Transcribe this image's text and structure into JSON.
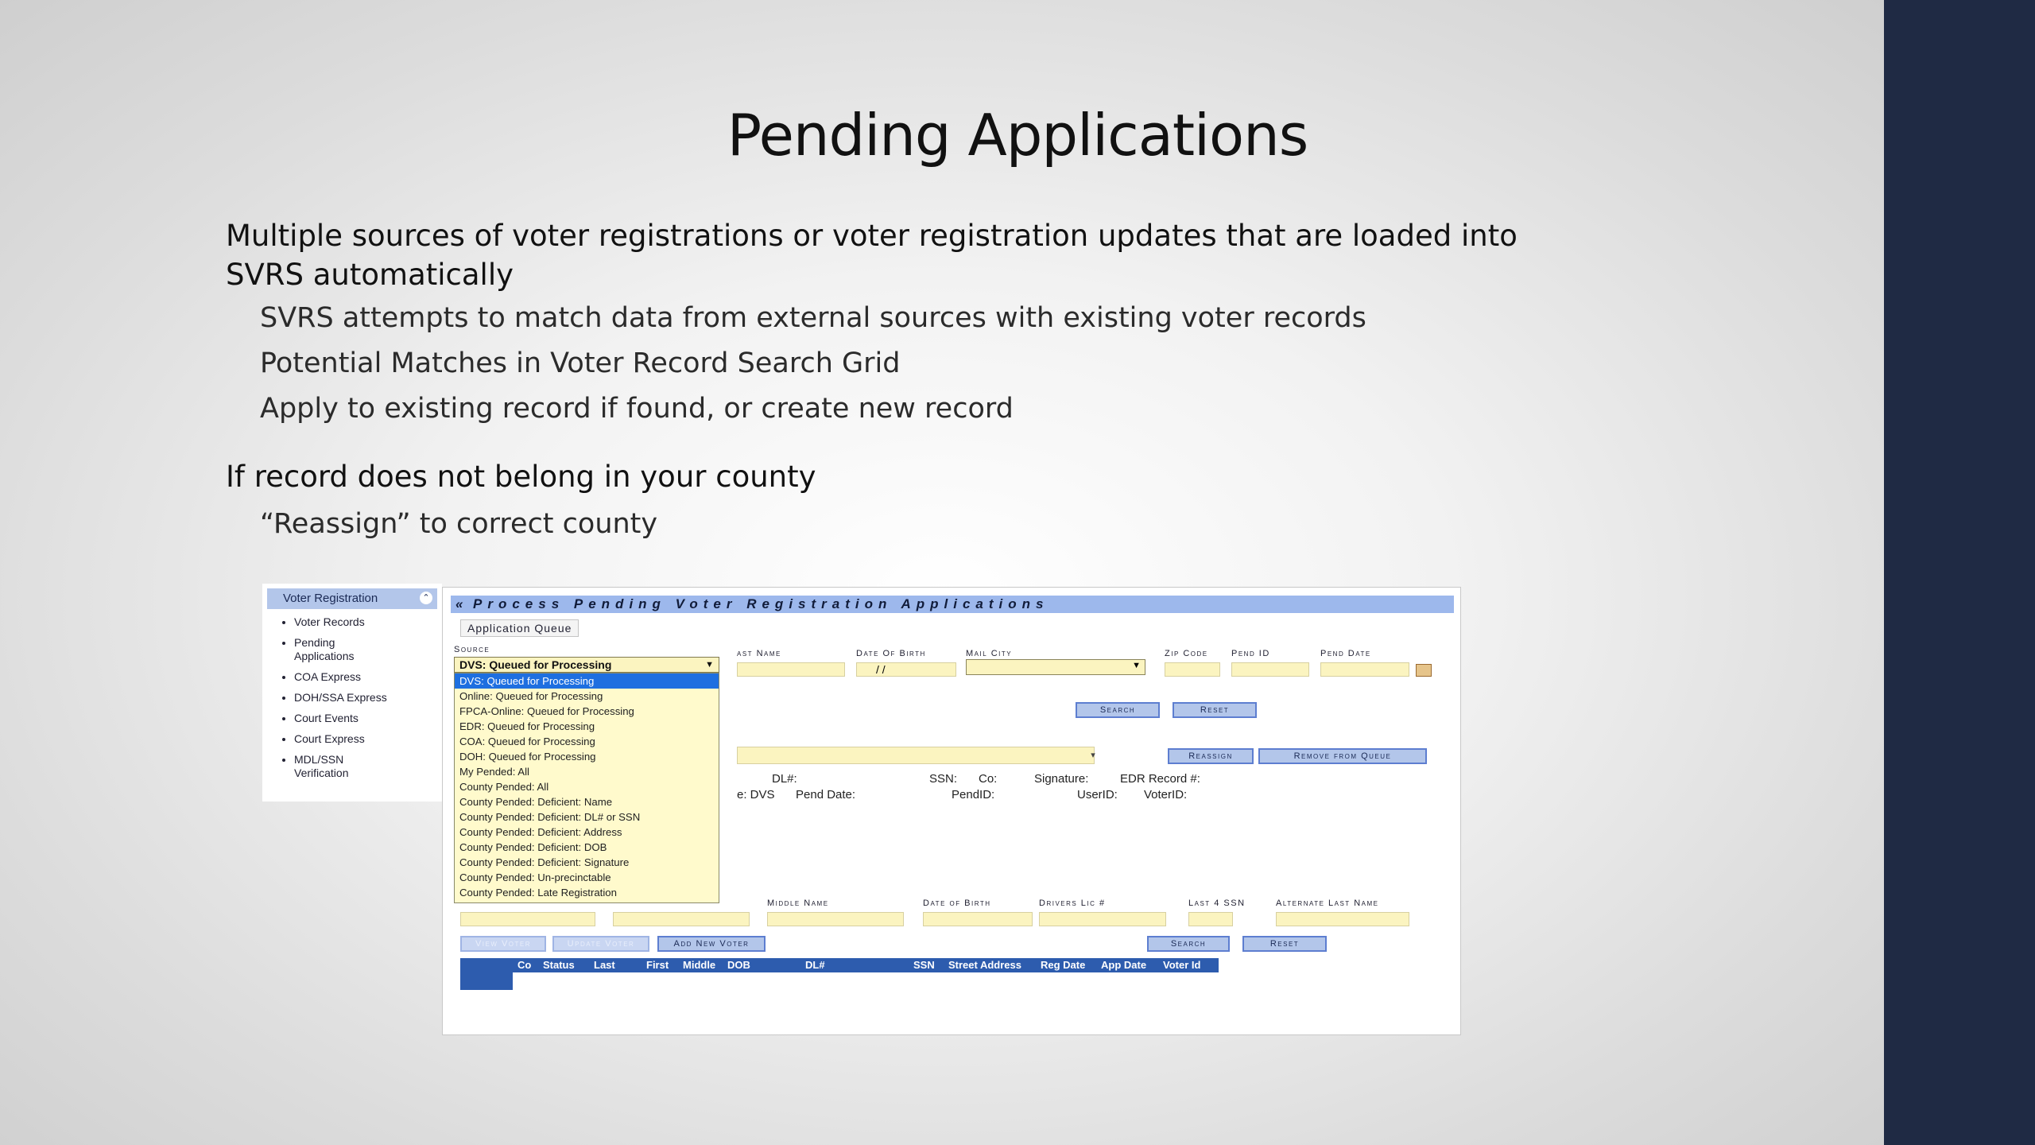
{
  "slide": {
    "title": "Pending Applications",
    "bullets": [
      {
        "text": "Multiple sources of voter registrations or voter registration updates that are loaded into SVRS automatically",
        "children": [
          "SVRS attempts to match data from external sources with existing voter records",
          "Potential Matches in Voter Record Search Grid",
          "Apply to existing record if found, or create new record"
        ]
      },
      {
        "text": "If record does not belong in your county",
        "children": [
          "“Reassign” to correct county"
        ]
      }
    ]
  },
  "nav": {
    "header": "Voter Registration",
    "items": [
      "Voter Records",
      "Pending Applications",
      "COA Express",
      "DOH/SSA Express",
      "Court Events",
      "Court Express",
      "MDL/SSN Verification"
    ]
  },
  "app": {
    "title": "Process Pending Voter Registration Applications",
    "tab": "Application Queue",
    "labels": {
      "source": "Source",
      "last_name": "ast Name",
      "date_of_birth": "Date Of Birth",
      "mail_city": "Mail City",
      "zip_code": "Zip Code",
      "pend_id": "Pend ID",
      "pend_date": "Pend Date",
      "middle_name": "Middle Name",
      "dob2": "Date of Birth",
      "drivers_lic": "Drivers Lic #",
      "last4ssn": "Last 4 SSN",
      "alt_last_name": "Alternate Last Name"
    },
    "dob_placeholder": "/   /",
    "source_selected": "DVS: Queued for Processing",
    "source_options": [
      "DVS: Queued for Processing",
      "Online: Queued for Processing",
      "FPCA-Online: Queued for Processing",
      "EDR: Queued for Processing",
      "COA: Queued for Processing",
      "DOH: Queued for Processing",
      "My Pended: All",
      "County Pended: All",
      "County Pended: Deficient: Name",
      "County Pended: Deficient: DL# or SSN",
      "County Pended: Deficient: Address",
      "County Pended: Deficient: DOB",
      "County Pended: Deficient: Signature",
      "County Pended: Un-precinctable",
      "County Pended: Late Registration"
    ],
    "buttons": {
      "search": "Search",
      "reset": "Reset",
      "reassign": "Reassign",
      "remove": "Remove from Queue",
      "view_voter": "View Voter",
      "update_voter": "Update Voter",
      "add_voter": "Add New Voter"
    },
    "detail_row1": [
      "DL#:",
      "SSN:",
      "Co:",
      "Signature:",
      "EDR Record #:"
    ],
    "detail_row2": [
      "e: DVS",
      "Pend Date:",
      "PendID:",
      "UserID:",
      "VoterID:"
    ],
    "grid_columns": [
      "Co",
      "Status",
      "Last",
      "First",
      "Middle",
      "DOB",
      "DL#",
      "SSN",
      "Street Address",
      "Reg Date",
      "App Date",
      "Voter Id"
    ]
  },
  "colors": {
    "navy_band": "#1f2a44",
    "header_blue": "#9db8ec",
    "field_yellow": "#fbf4c0",
    "grid_blue": "#2d5cae",
    "highlight": "#1e6fe0"
  }
}
